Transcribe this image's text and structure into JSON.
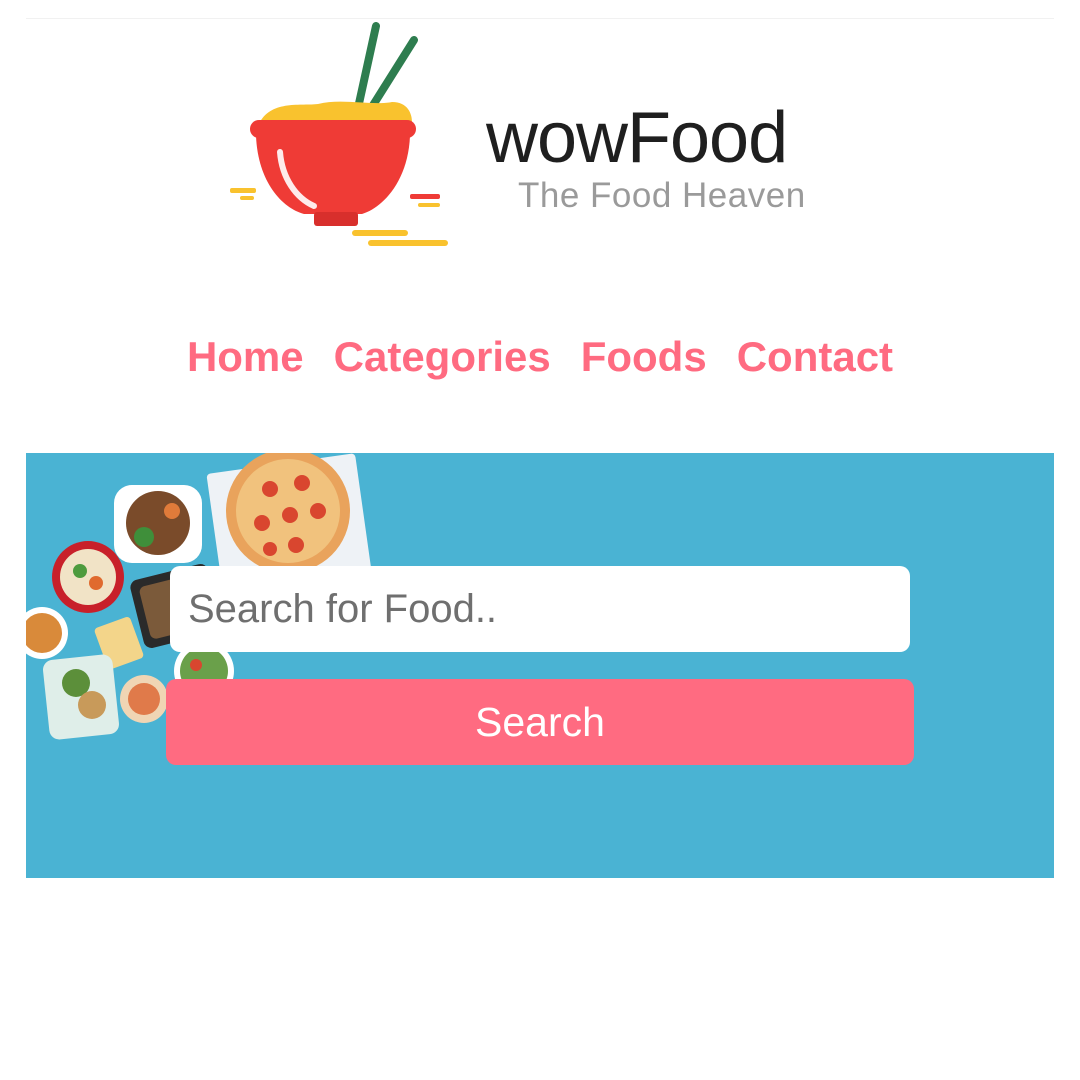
{
  "brand": {
    "name": "wowFood",
    "tagline": "The Food Heaven",
    "logo_icon": "noodle-bowl-icon"
  },
  "nav": {
    "items": [
      {
        "label": "Home"
      },
      {
        "label": "Categories"
      },
      {
        "label": "Foods"
      },
      {
        "label": "Contact"
      }
    ]
  },
  "search": {
    "placeholder": "Search for Food..",
    "value": "",
    "button_label": "Search"
  },
  "colors": {
    "accent": "#ff6b81",
    "hero_background": "#4ab3d3",
    "bowl": "#ef3b36",
    "noodles": "#f9c22e",
    "chopsticks": "#2e7d4f"
  }
}
